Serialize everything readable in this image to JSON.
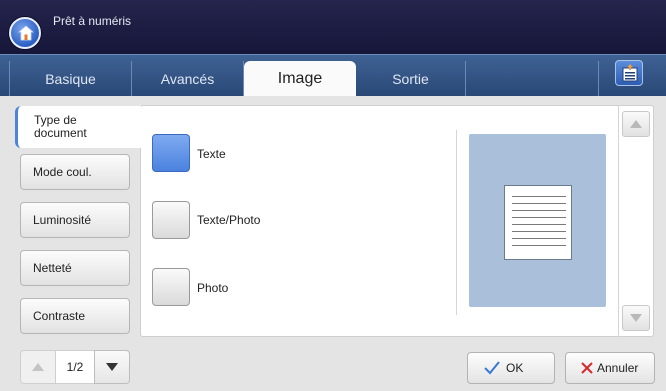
{
  "header": {
    "title": "Prêt à numéris",
    "home_icon": "home-icon"
  },
  "tabs": [
    {
      "label": "Basique",
      "active": false
    },
    {
      "label": "Avancés",
      "active": false
    },
    {
      "label": "Image",
      "active": true
    },
    {
      "label": "Sortie",
      "active": false
    }
  ],
  "tab_tools": {
    "icon": "clipboard-arrow-icon"
  },
  "sidebar": {
    "items": [
      {
        "label": "Type de document",
        "active": true
      },
      {
        "label": "Mode coul.",
        "active": false
      },
      {
        "label": "Luminosité",
        "active": false
      },
      {
        "label": "Netteté",
        "active": false
      },
      {
        "label": "Contraste",
        "active": false
      }
    ]
  },
  "options": [
    {
      "label": "Texte",
      "selected": true
    },
    {
      "label": "Texte/Photo",
      "selected": false
    },
    {
      "label": "Photo",
      "selected": false
    }
  ],
  "preview": {
    "icon": "text-document-icon"
  },
  "pager": {
    "text": "1/2"
  },
  "actions": {
    "ok_label": "OK",
    "cancel_label": "Annuler"
  },
  "colors": {
    "accent": "#4b82de",
    "header_bg": "#1c1c42",
    "tabbar_bg": "#33557f",
    "preview_bg": "#a9bfda",
    "ok_check": "#3a78d8",
    "cancel_x": "#d62a2a"
  }
}
